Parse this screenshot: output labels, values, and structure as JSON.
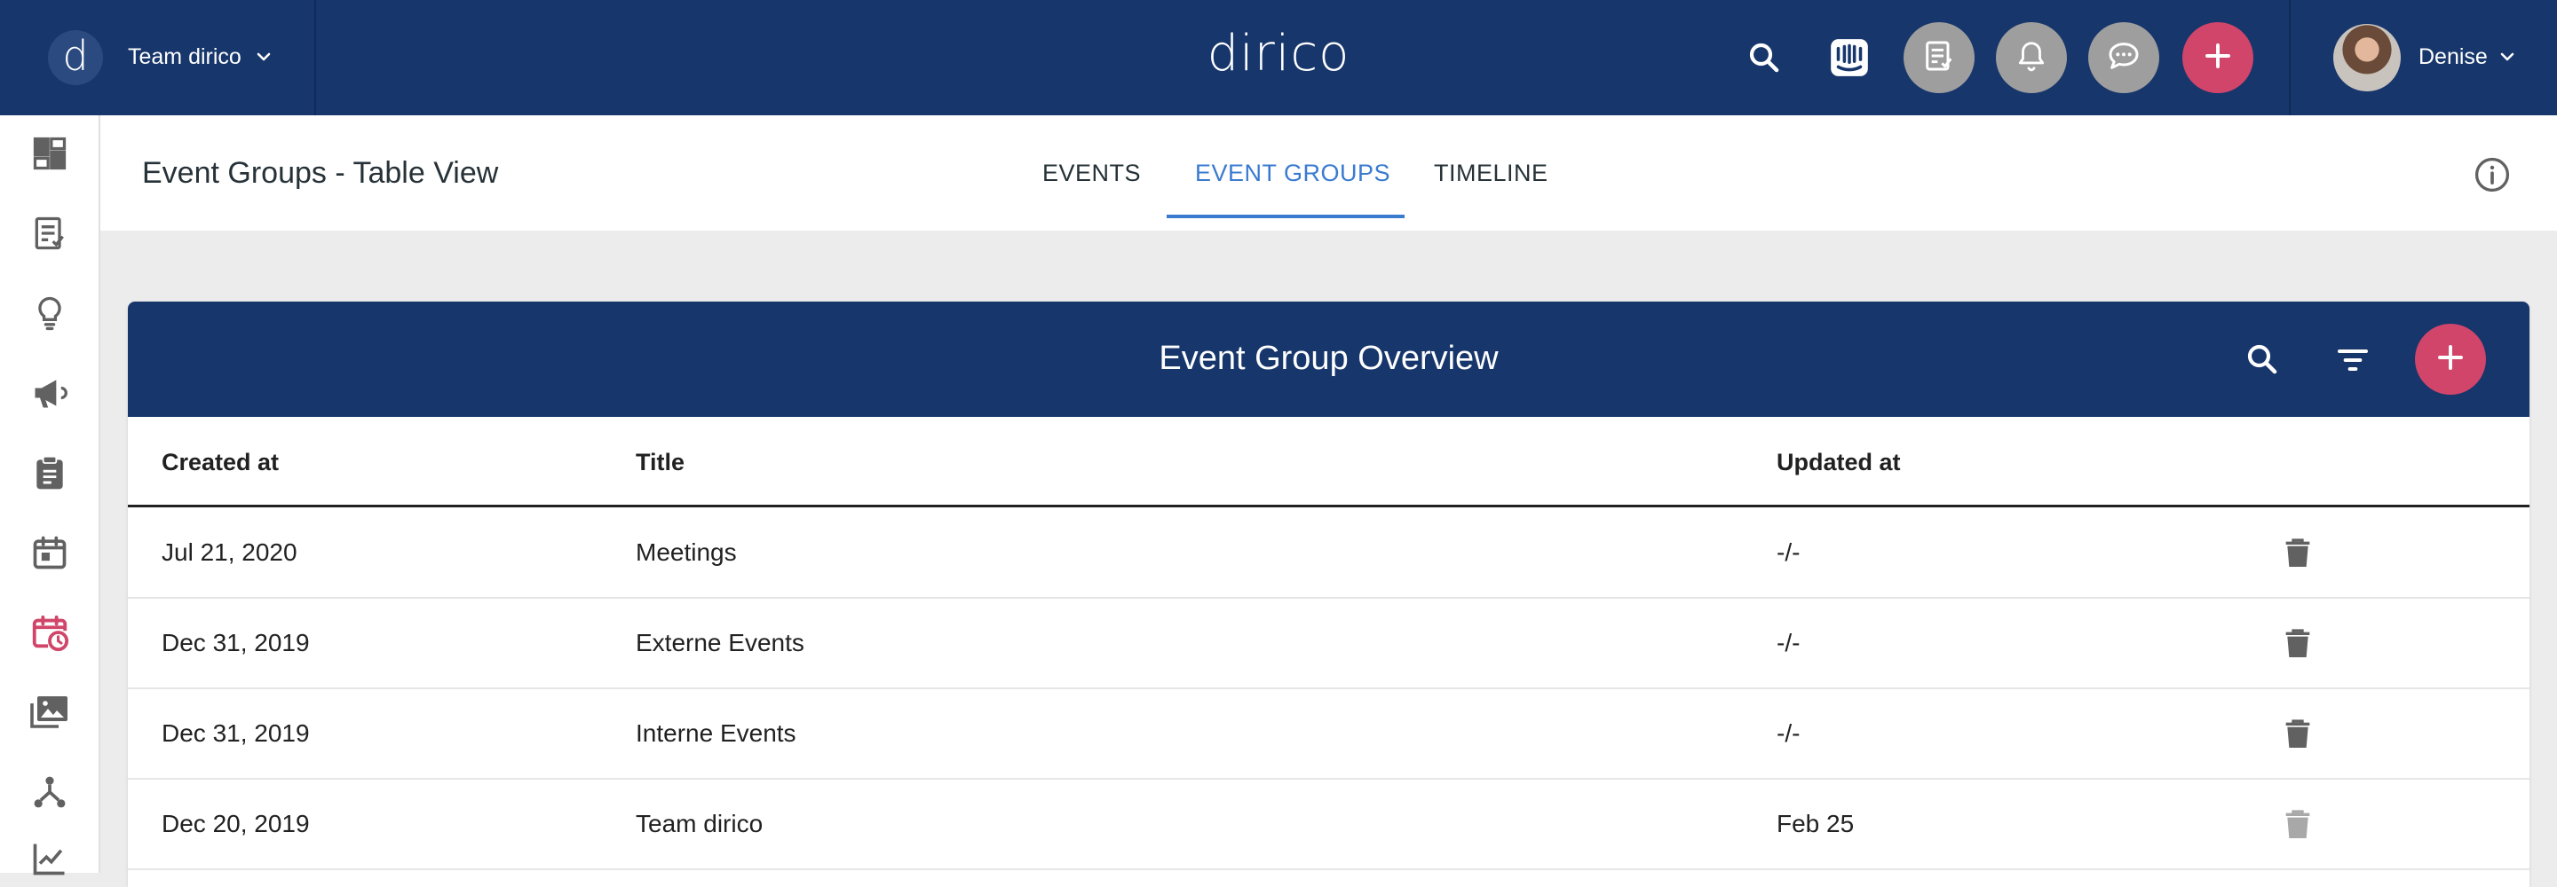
{
  "colors": {
    "primary": "#17366b",
    "accent": "#d1456a",
    "tab_active": "#3a7bd0",
    "background": "#ececec"
  },
  "topbar": {
    "logo_letter": "d",
    "team_name": "Team dirico",
    "brand": "dirico",
    "user_name": "Denise",
    "icons": [
      "search-icon",
      "intercom-icon",
      "notes-icon",
      "bell-icon",
      "chat-icon",
      "plus-icon"
    ]
  },
  "sidebar": {
    "items": [
      {
        "icon": "dashboard-icon",
        "active": false
      },
      {
        "icon": "checklist-icon",
        "active": false
      },
      {
        "icon": "lightbulb-icon",
        "active": false
      },
      {
        "icon": "megaphone-icon",
        "active": false
      },
      {
        "icon": "clipboard-icon",
        "active": false
      },
      {
        "icon": "calendar-icon",
        "active": false
      },
      {
        "icon": "calendar-clock-icon",
        "active": true
      },
      {
        "icon": "media-library-icon",
        "active": false
      },
      {
        "icon": "hierarchy-icon",
        "active": false
      },
      {
        "icon": "analytics-icon",
        "active": false
      }
    ]
  },
  "page": {
    "title": "Event Groups - Table View",
    "tabs": [
      {
        "label": "EVENTS",
        "active": false
      },
      {
        "label": "EVENT GROUPS",
        "active": true
      },
      {
        "label": "TIMELINE",
        "active": false
      }
    ]
  },
  "card": {
    "title": "Event Group Overview",
    "columns": [
      "Created at",
      "Title",
      "Updated at"
    ],
    "rows": [
      {
        "created": "Jul 21, 2020",
        "title": "Meetings",
        "updated": "-/-"
      },
      {
        "created": "Dec 31, 2019",
        "title": "Externe Events",
        "updated": "-/-"
      },
      {
        "created": "Dec 31, 2019",
        "title": "Interne Events",
        "updated": "-/-"
      },
      {
        "created": "Dec 20, 2019",
        "title": "Team dirico",
        "updated": "Feb 25"
      }
    ]
  }
}
